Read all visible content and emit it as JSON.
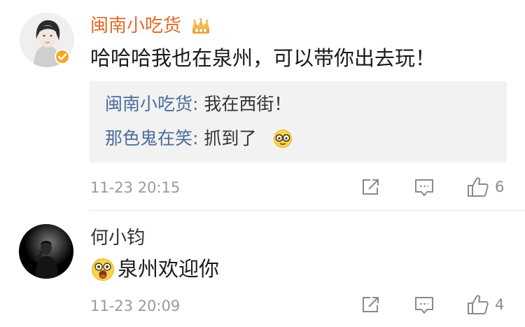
{
  "comments": [
    {
      "author": "闽南小吃货",
      "text": "哈哈哈我也在泉州，可以带你出去玩！",
      "icons": [
        "avatar",
        "verified-badge-icon",
        "vip-crown-icon"
      ],
      "replies": [
        {
          "author": "闽南小吃货",
          "separator": ": ",
          "text": "我在西街！"
        },
        {
          "author": "那色鬼在笑",
          "separator": ": ",
          "text": "抓到了",
          "emoji": "glasses-face-emoji"
        }
      ],
      "time": "11-23 20:15",
      "like_count": "6",
      "colors": {
        "author": "#e06c2a",
        "badge": "#f5a623"
      }
    },
    {
      "author": "何小钧",
      "text": "泉州欢迎你",
      "emoji": "shocked-face-emoji",
      "time": "11-23 20:09",
      "like_count": "4"
    }
  ],
  "actions": {
    "share_icon": "share-icon",
    "reply_icon": "comment-icon",
    "like_icon": "thumbs-up-icon"
  },
  "colors": {
    "reply_author": "#4a6d9c",
    "reply_background": "#f2f2f2",
    "timestamp": "#9a9a9a"
  }
}
